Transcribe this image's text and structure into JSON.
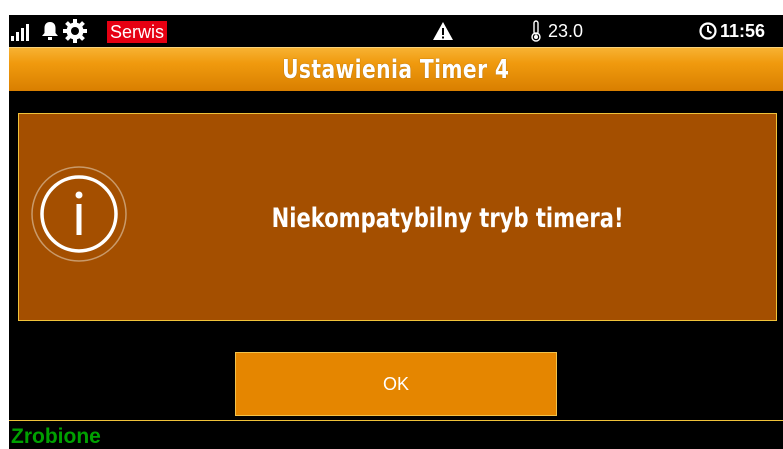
{
  "status_bar": {
    "mode_badge": "Serwis",
    "temperature": "23.0",
    "time": "11:56",
    "icons": [
      "signal-icon",
      "bell-icon",
      "gear-icon",
      "warning-icon",
      "thermometer-icon",
      "clock-icon"
    ]
  },
  "title": "Ustawienia Timer 4",
  "dialog": {
    "icon": "info-icon",
    "message": "Niekompatybilny tryb timera!"
  },
  "button": {
    "label": "OK"
  },
  "footer": {
    "status": "Zrobione"
  },
  "colors": {
    "background": "#000000",
    "title_bar": "#f09a0e",
    "dialog_bg": "#a44f00",
    "dialog_border": "#f0c23a",
    "button_bg": "#e58600",
    "badge": "#e60012",
    "footer_text": "#00a000"
  }
}
